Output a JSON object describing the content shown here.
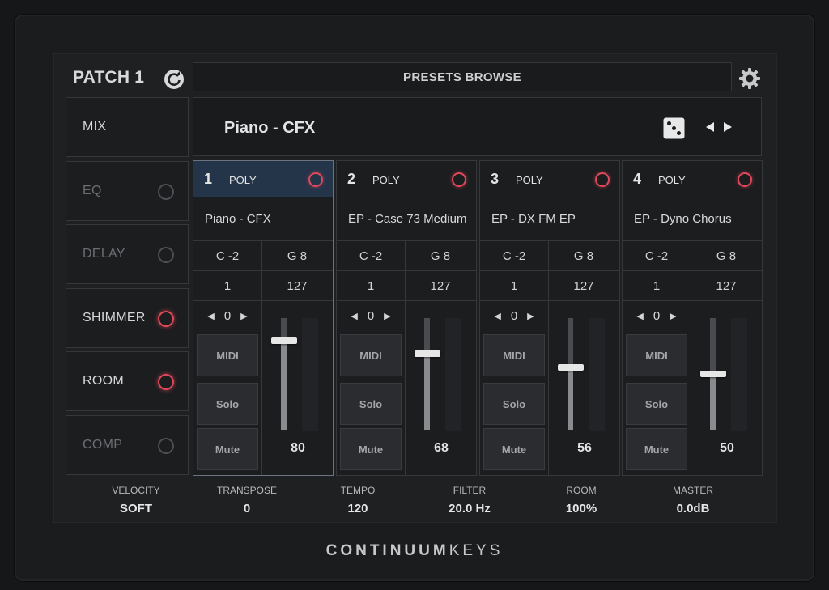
{
  "patch": {
    "title": "PATCH 1"
  },
  "presets": {
    "browse_label": "PRESETS BROWSE",
    "current_name": "Piano - CFX"
  },
  "sidebar": {
    "items": [
      {
        "label": "MIX",
        "enabled": true
      },
      {
        "label": "EQ",
        "enabled": false
      },
      {
        "label": "DELAY",
        "enabled": false
      },
      {
        "label": "SHIMMER",
        "enabled": true
      },
      {
        "label": "ROOM",
        "enabled": true
      },
      {
        "label": "COMP",
        "enabled": false
      }
    ]
  },
  "channels": [
    {
      "num": "1",
      "mode": "POLY",
      "instrument": "Piano - CFX",
      "low_note": "C -2",
      "high_note": "G 8",
      "min_vel": "1",
      "max_vel": "127",
      "transpose": "0",
      "midi": "MIDI",
      "solo": "Solo",
      "mute": "Mute",
      "level": "80",
      "level_value": 80,
      "selected": true
    },
    {
      "num": "2",
      "mode": "POLY",
      "instrument": "EP - Case 73 Medium",
      "low_note": "C -2",
      "high_note": "G 8",
      "min_vel": "1",
      "max_vel": "127",
      "transpose": "0",
      "midi": "MIDI",
      "solo": "Solo",
      "mute": "Mute",
      "level": "68",
      "level_value": 68,
      "selected": false
    },
    {
      "num": "3",
      "mode": "POLY",
      "instrument": "EP - DX FM EP",
      "low_note": "C -2",
      "high_note": "G 8",
      "min_vel": "1",
      "max_vel": "127",
      "transpose": "0",
      "midi": "MIDI",
      "solo": "Solo",
      "mute": "Mute",
      "level": "56",
      "level_value": 56,
      "selected": false
    },
    {
      "num": "4",
      "mode": "POLY",
      "instrument": "EP - Dyno Chorus",
      "low_note": "C -2",
      "high_note": "G 8",
      "min_vel": "1",
      "max_vel": "127",
      "transpose": "0",
      "midi": "MIDI",
      "solo": "Solo",
      "mute": "Mute",
      "level": "50",
      "level_value": 50,
      "selected": false
    }
  ],
  "stats": [
    {
      "label": "VELOCITY",
      "value": "SOFT"
    },
    {
      "label": "TRANSPOSE",
      "value": "0"
    },
    {
      "label": "TEMPO",
      "value": "120"
    },
    {
      "label": "FILTER",
      "value": "20.0 Hz"
    },
    {
      "label": "ROOM",
      "value": "100%"
    },
    {
      "label": "MASTER",
      "value": "0.0dB"
    }
  ],
  "brand": {
    "strong": "CONTINUUM",
    "light": "KEYS"
  },
  "colors": {
    "active_ring": "#e0485a",
    "selected_header": "#24354a",
    "panel": "#1f2022"
  },
  "icons": [
    "refresh-icon",
    "gear-icon",
    "dice-icon",
    "arrow-left-icon",
    "arrow-right-icon"
  ]
}
